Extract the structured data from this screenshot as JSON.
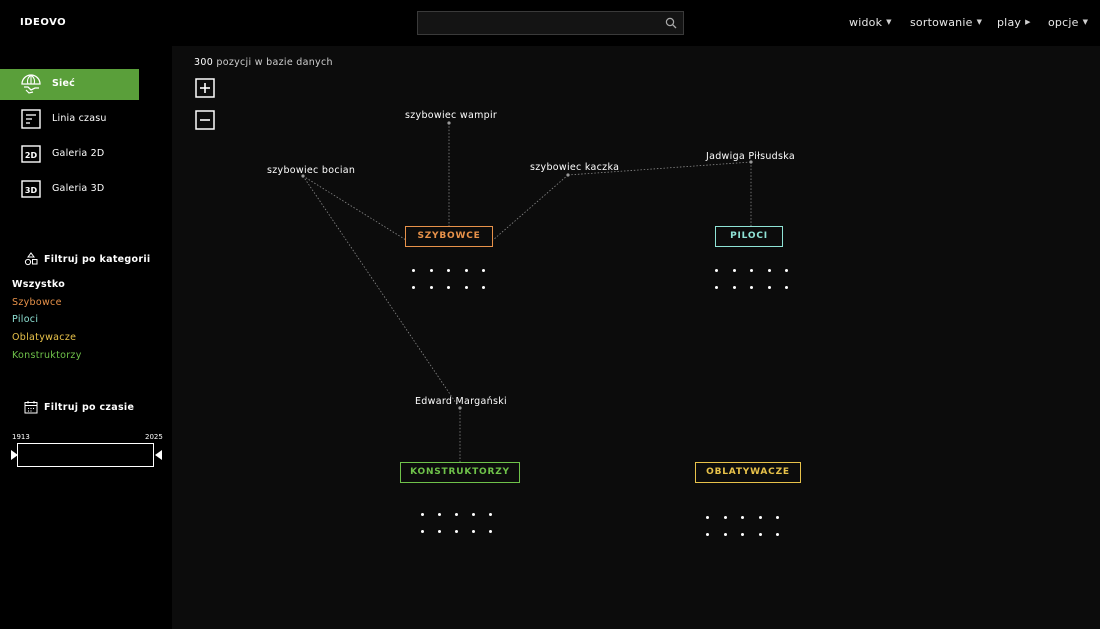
{
  "app": {
    "logo": "IDEOVO"
  },
  "search": {
    "placeholder": "",
    "value": ""
  },
  "menu": [
    {
      "label": "widok",
      "caret": "down"
    },
    {
      "label": "sortowanie",
      "caret": "down"
    },
    {
      "label": "play",
      "caret": "right"
    },
    {
      "label": "opcje",
      "caret": "down"
    }
  ],
  "sidebar": {
    "views": [
      {
        "label": "Sieć",
        "icon": "globe-hand-icon",
        "active": true
      },
      {
        "label": "Linia czasu",
        "icon": "timeline-icon",
        "active": false
      },
      {
        "label": "Galeria 2D",
        "icon": "gallery-2d-icon",
        "active": false
      },
      {
        "label": "Galeria 3D",
        "icon": "gallery-3d-icon",
        "active": false
      }
    ],
    "category_filter": {
      "title": "Filtruj po kategorii",
      "items": [
        {
          "label": "Wszystko",
          "color": "#ffffff",
          "bold": true
        },
        {
          "label": "Szybowce",
          "color": "#e8924a"
        },
        {
          "label": "Piloci",
          "color": "#8fe3d6"
        },
        {
          "label": "Oblatywacze",
          "color": "#e8c24a"
        },
        {
          "label": "Konstruktorzy",
          "color": "#6fc24a"
        }
      ]
    },
    "time_filter": {
      "title": "Filtruj po czasie",
      "start_year": "1913",
      "end_year": "2025"
    }
  },
  "main": {
    "count_number": "300",
    "count_text": "pozycji w bazie danych",
    "nodes": {
      "wampir": "szybowiec wampir",
      "bocian": "szybowiec bocian",
      "kaczka": "szybowiec kaczka",
      "pilsudska": "Jadwiga Piłsudska",
      "marganski": "Edward Margański"
    },
    "groups": {
      "szybowce": {
        "label": "SZYBOWCE",
        "color": "#e8924a"
      },
      "piloci": {
        "label": "PILOCI",
        "color": "#8fe3d6"
      },
      "konstruktorzy": {
        "label": "KONSTRUKTORZY",
        "color": "#6fc24a"
      },
      "oblatywacze": {
        "label": "OBLATYWACZE",
        "color": "#e8c24a"
      }
    }
  }
}
